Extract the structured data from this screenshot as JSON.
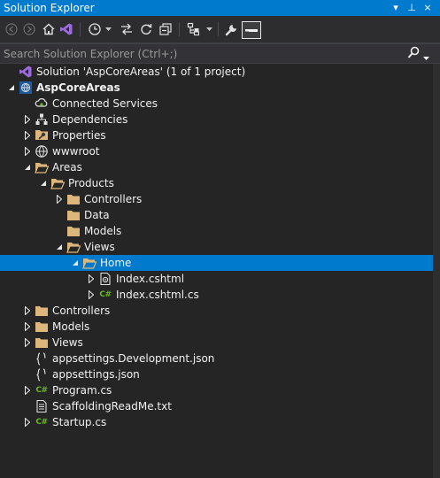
{
  "window": {
    "title": "Solution Explorer",
    "controls": [
      "▾",
      "⊥",
      "×"
    ]
  },
  "search": {
    "placeholder": "Search Solution Explorer (Ctrl+;)"
  },
  "colors": {
    "accent": "#007acc",
    "folder": "#dcb67a",
    "csharp": "#68b723",
    "background": "#252526"
  },
  "tree": [
    {
      "label": "Solution 'AspCoreAreas' (1 of 1 project)",
      "icon": "solution-icon",
      "level": 0,
      "arrow": "none",
      "bold": false
    },
    {
      "label": "AspCoreAreas",
      "icon": "web-project-icon",
      "level": 0,
      "arrow": "expanded",
      "bold": true
    },
    {
      "label": "Connected Services",
      "icon": "connected-services-icon",
      "level": 1,
      "arrow": "none",
      "bold": false
    },
    {
      "label": "Dependencies",
      "icon": "dependencies-icon",
      "level": 1,
      "arrow": "collapsed",
      "bold": false
    },
    {
      "label": "Properties",
      "icon": "properties-icon",
      "level": 1,
      "arrow": "collapsed",
      "bold": false
    },
    {
      "label": "wwwroot",
      "icon": "globe-icon",
      "level": 1,
      "arrow": "collapsed",
      "bold": false
    },
    {
      "label": "Areas",
      "icon": "folder-open-icon",
      "level": 1,
      "arrow": "expanded",
      "bold": false
    },
    {
      "label": "Products",
      "icon": "folder-open-icon",
      "level": 2,
      "arrow": "expanded",
      "bold": false
    },
    {
      "label": "Controllers",
      "icon": "folder-icon",
      "level": 3,
      "arrow": "collapsed",
      "bold": false
    },
    {
      "label": "Data",
      "icon": "folder-icon",
      "level": 3,
      "arrow": "none",
      "bold": false
    },
    {
      "label": "Models",
      "icon": "folder-icon",
      "level": 3,
      "arrow": "none",
      "bold": false
    },
    {
      "label": "Views",
      "icon": "folder-open-icon",
      "level": 3,
      "arrow": "expanded",
      "bold": false
    },
    {
      "label": "Home",
      "icon": "folder-open-icon",
      "level": 4,
      "arrow": "expanded",
      "bold": false,
      "selected": true
    },
    {
      "label": "Index.cshtml",
      "icon": "razor-file-icon",
      "level": 5,
      "arrow": "collapsed",
      "bold": false
    },
    {
      "label": "Index.cshtml.cs",
      "icon": "csharp-file-icon",
      "level": 5,
      "arrow": "collapsed",
      "bold": false
    },
    {
      "label": "Controllers",
      "icon": "folder-icon",
      "level": 1,
      "arrow": "collapsed",
      "bold": false
    },
    {
      "label": "Models",
      "icon": "folder-icon",
      "level": 1,
      "arrow": "collapsed",
      "bold": false
    },
    {
      "label": "Views",
      "icon": "folder-icon",
      "level": 1,
      "arrow": "collapsed",
      "bold": false
    },
    {
      "label": "appsettings.Development.json",
      "icon": "json-file-icon",
      "level": 1,
      "arrow": "none",
      "bold": false
    },
    {
      "label": "appsettings.json",
      "icon": "json-file-icon",
      "level": 1,
      "arrow": "none",
      "bold": false
    },
    {
      "label": "Program.cs",
      "icon": "csharp-file-icon",
      "level": 1,
      "arrow": "collapsed",
      "bold": false
    },
    {
      "label": "ScaffoldingReadMe.txt",
      "icon": "text-file-icon",
      "level": 1,
      "arrow": "none",
      "bold": false
    },
    {
      "label": "Startup.cs",
      "icon": "csharp-file-icon",
      "level": 1,
      "arrow": "collapsed",
      "bold": false
    }
  ]
}
